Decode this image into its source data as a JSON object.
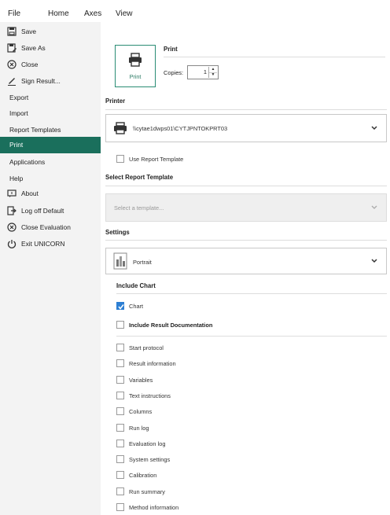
{
  "menu": {
    "file": "File",
    "home": "Home",
    "axes": "Axes",
    "view": "View"
  },
  "sidebar": {
    "items": [
      {
        "label": "Save",
        "icon": "save-icon"
      },
      {
        "label": "Save As",
        "icon": "save-as-icon"
      },
      {
        "label": "Close",
        "icon": "close-circle-icon"
      },
      {
        "label": "Sign Result...",
        "icon": "sign-icon"
      },
      {
        "label": "Export"
      },
      {
        "label": "Import"
      },
      {
        "label": "Report Templates"
      },
      {
        "label": "Print",
        "active": true
      },
      {
        "label": "Applications"
      },
      {
        "label": "Help"
      },
      {
        "label": "About",
        "icon": "about-icon"
      },
      {
        "label": "Log off Default",
        "icon": "logoff-icon"
      },
      {
        "label": "Close Evaluation",
        "icon": "close-circle-icon"
      },
      {
        "label": "Exit UNICORN",
        "icon": "power-icon"
      }
    ]
  },
  "print": {
    "button_label": "Print",
    "title": "Print",
    "copies_label": "Copies:",
    "copies_value": "1"
  },
  "printer": {
    "section": "Printer",
    "name": "\\\\cytae1dwps01\\CYTJPNTOKPRT03"
  },
  "report_template": {
    "use_label": "Use Report Template",
    "section": "Select Report Template",
    "placeholder": "Select a template..."
  },
  "settings": {
    "section": "Settings",
    "orientation": "Portrait"
  },
  "include_chart": {
    "section": "Include Chart",
    "chart_label": "Chart",
    "chart_checked": true
  },
  "result_doc": {
    "label": "Include Result Documentation",
    "items": [
      "Start protocol",
      "Result information",
      "Variables",
      "Text instructions",
      "Columns",
      "Run log",
      "Evaluation log",
      "System settings",
      "Calibration",
      "Run summary",
      "Method information"
    ]
  },
  "colors": {
    "accent": "#1a6f5c",
    "checkbox": "#2d7fd3"
  }
}
